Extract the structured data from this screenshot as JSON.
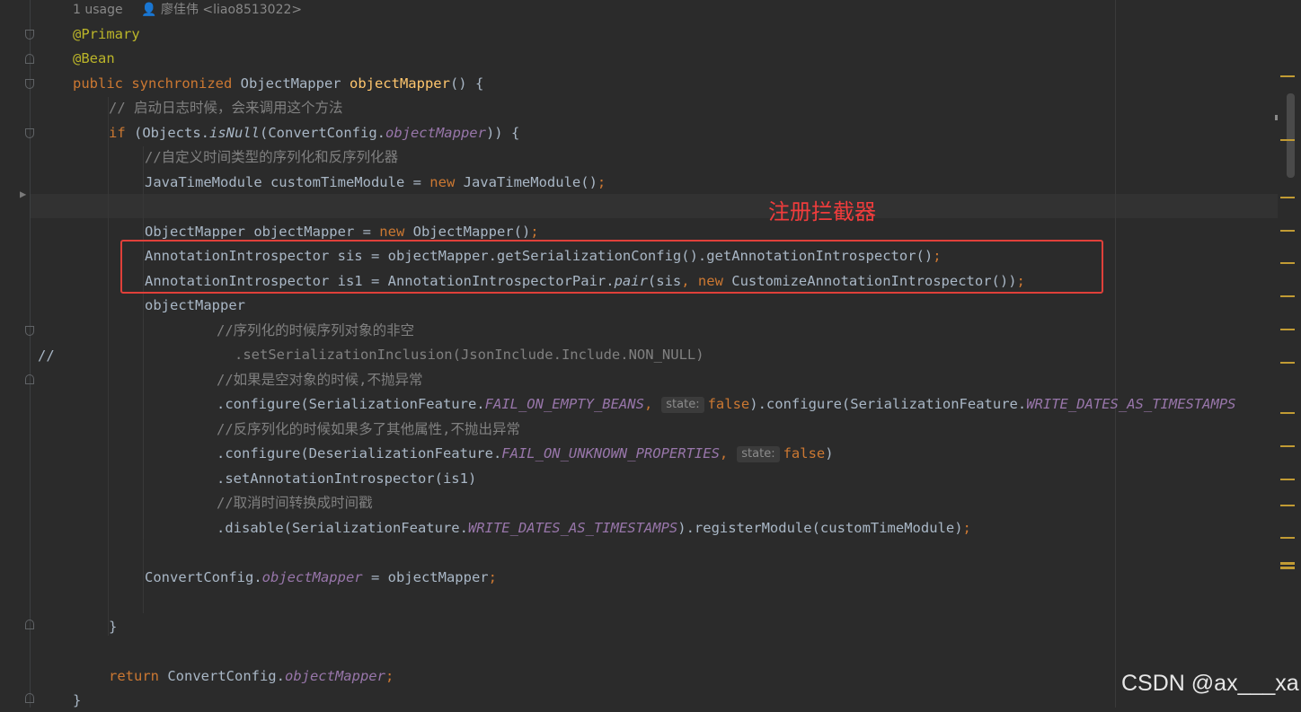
{
  "usage_hint": {
    "count": "1 usage",
    "author": "廖佳伟 <liao8513022>"
  },
  "gutter_comment": "//",
  "annotation_note": "注册拦截器",
  "watermark": "CSDN @ax___xa",
  "hints": {
    "state": "state:"
  },
  "code": {
    "l1": "@Primary",
    "l2": "@Bean",
    "l3_public": "public ",
    "l3_sync": "synchronized ",
    "l3_type": "ObjectMapper ",
    "l3_method": "objectMapper",
    "l3_rest": "() {",
    "l4": "// 启动日志时候，会来调用这个方法",
    "l5_if": "if ",
    "l5_a": "(Objects.",
    "l5_isnull": "isNull",
    "l5_b": "(ConvertConfig.",
    "l5_field": "objectMapper",
    "l5_c": ")) {",
    "l6": "//自定义时间类型的序列化和反序列化器",
    "l7_a": "JavaTimeModule customTimeModule = ",
    "l7_new": "new ",
    "l7_b": "JavaTimeModule()",
    "semi": ";",
    "l9_a": "ObjectMapper objectMapper = ",
    "l9_new": "new ",
    "l9_b": "ObjectMapper()",
    "l10": "AnnotationIntrospector sis = objectMapper.getSerializationConfig().getAnnotationIntrospector()",
    "l11_a": "AnnotationIntrospector is1 = AnnotationIntrospectorPair.",
    "l11_pair": "pair",
    "l11_b": "(sis",
    "l11_comma": ", ",
    "l11_new": "new ",
    "l11_c": "CustomizeAnnotationIntrospector())",
    "l12": "objectMapper",
    "l13": "//序列化的时候序列对象的非空",
    "l14": ".setSerializationInclusion(JsonInclude.Include.NON_NULL)",
    "l15": "//如果是空对象的时候,不抛异常",
    "l16_a": ".configure(SerializationFeature.",
    "l16_f1": "FAIL_ON_EMPTY_BEANS",
    "l16_comma": ",",
    "l16_false": "false",
    "l16_b": ").configure(SerializationFeature.",
    "l16_f2": "WRITE_DATES_AS_TIMESTAMPS",
    "l17": "//反序列化的时候如果多了其他属性,不抛出异常",
    "l18_a": ".configure(DeserializationFeature.",
    "l18_f": "FAIL_ON_UNKNOWN_PROPERTIES",
    "l18_comma": ",",
    "l18_false": "false",
    "l18_b": ")",
    "l19": ".setAnnotationIntrospector(is1)",
    "l20": "//取消时间转换成时间戳",
    "l21_a": ".disable(SerializationFeature.",
    "l21_f": "WRITE_DATES_AS_TIMESTAMPS",
    "l21_b": ").registerModule(customTimeModule)",
    "l23_a": "ConvertConfig.",
    "l23_f": "objectMapper",
    "l23_b": " = objectMapper",
    "l25": "}",
    "l27_ret": "return ",
    "l27_a": "ConvertConfig.",
    "l27_f": "objectMapper",
    "l28": "}"
  },
  "colors": {
    "keyword": "#cc7832",
    "annotation": "#bbb529",
    "method": "#ffc66d",
    "comment": "#808080",
    "field": "#9876aa",
    "text": "#a9b7c6",
    "highlight_box": "#e0403a"
  }
}
